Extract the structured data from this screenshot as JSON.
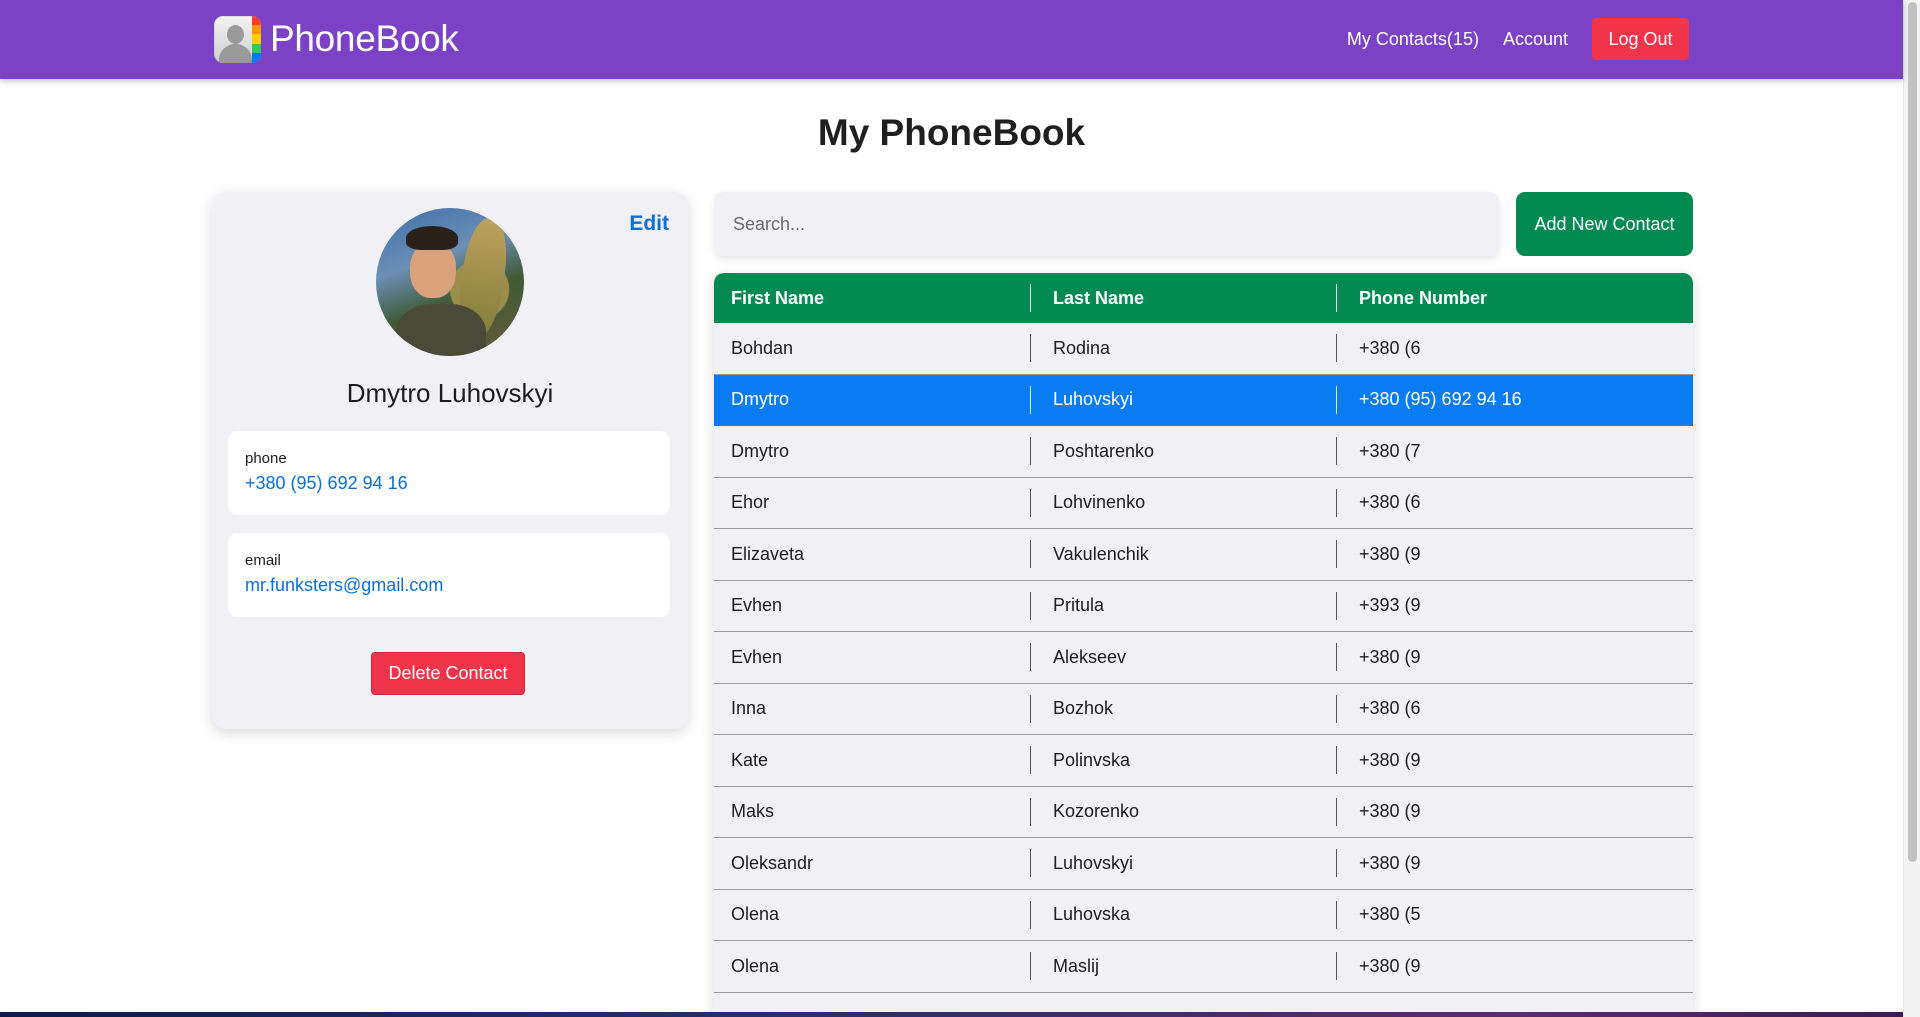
{
  "app": {
    "brand": "PhoneBook",
    "colors": {
      "navbar": "#7b42c6",
      "primary_green": "#028a52",
      "danger": "#f1344a",
      "selected_row": "#0a7cf2",
      "link_blue": "#0a6fd6"
    }
  },
  "nav": {
    "my_contacts": "My Contacts(15)",
    "account": "Account",
    "logout": "Log Out"
  },
  "page": {
    "title": "My PhoneBook"
  },
  "profile": {
    "edit": "Edit",
    "name": "Dmytro Luhovskyi",
    "phone_label": "phone",
    "phone": "+380 (95) 692 94 16",
    "email_label": "email",
    "email": "mr.funksters@gmail.com",
    "delete": "Delete Contact"
  },
  "search": {
    "placeholder": "Search...",
    "value": ""
  },
  "add_button": "Add New Contact",
  "table": {
    "headers": [
      "First Name",
      "Last Name",
      "Phone Number"
    ],
    "rows": [
      {
        "first": "Bohdan",
        "last": "Rodina",
        "phone": "+380 (6"
      },
      {
        "first": "Dmytro",
        "last": "Luhovskyi",
        "phone": "+380 (95) 692 94 16",
        "selected": true
      },
      {
        "first": "Dmytro",
        "last": "Poshtarenko",
        "phone": "+380 (7"
      },
      {
        "first": "Ehor",
        "last": "Lohvinenko",
        "phone": "+380 (6"
      },
      {
        "first": "Elizaveta",
        "last": "Vakulenchik",
        "phone": "+380 (9"
      },
      {
        "first": "Evhen",
        "last": "Pritula",
        "phone": "+393 (9"
      },
      {
        "first": "Evhen",
        "last": "Alekseev",
        "phone": "+380 (9"
      },
      {
        "first": "Inna",
        "last": "Bozhok",
        "phone": "+380 (6"
      },
      {
        "first": "Kate",
        "last": "Polinvska",
        "phone": "+380 (9"
      },
      {
        "first": "Maks",
        "last": "Kozorenko",
        "phone": "+380 (9"
      },
      {
        "first": "Oleksandr",
        "last": "Luhovskyi",
        "phone": "+380 (9"
      },
      {
        "first": "Olena",
        "last": "Luhovska",
        "phone": "+380 (5"
      },
      {
        "first": "Olena",
        "last": "Maslij",
        "phone": "+380 (9"
      }
    ]
  }
}
